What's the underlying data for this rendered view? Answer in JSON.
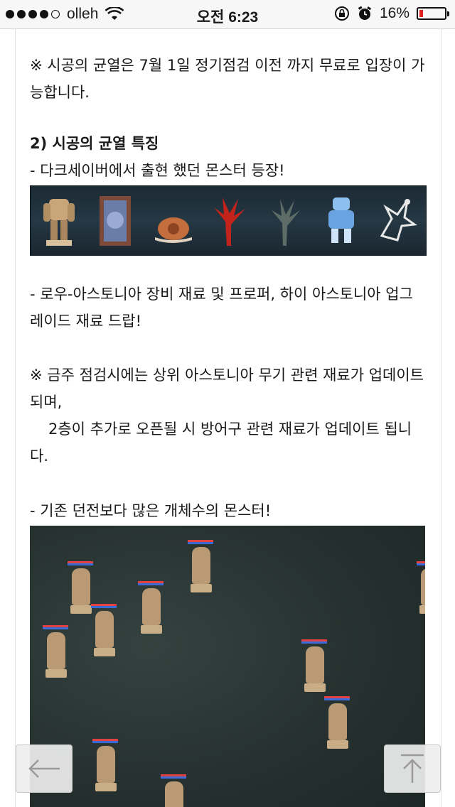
{
  "status_bar": {
    "carrier": "olleh",
    "time": "오전 6:23",
    "battery_percent": "16%",
    "battery_level": 0.16,
    "signal_dots_filled": 4,
    "signal_dots_total": 5
  },
  "article": {
    "note_free_entry": "※ 시공의 균열은 7월 1일 정기점검 이전 까지 무료로 입장이 가능합니다.",
    "section_heading": "2) 시공의 균열 특징",
    "bullet_monsters": "- 다크세이버에서 출현 했던 몬스터 등장!",
    "bullet_drops": "- 로우-아스토니아 장비 재료 및 프로퍼, 하이 아스토니아 업그레이드 재료 드랍!",
    "note_update_line1": "※ 금주 점검시에는 상위 아스토니아 무기 관련 재료가 업데이트 되며,",
    "note_update_line2": "2층이 추가로 오픈될 시 방어구 관련 재료가 업데이트 됩니다.",
    "bullet_more_monsters": "- 기존 던전보다 많은 개체수의 몬스터!"
  },
  "colors": {
    "battery_red": "#e0201c",
    "text": "#1a1a1a"
  },
  "icons": {
    "back": "arrow-left-icon",
    "top": "arrow-up-to-top-icon"
  }
}
